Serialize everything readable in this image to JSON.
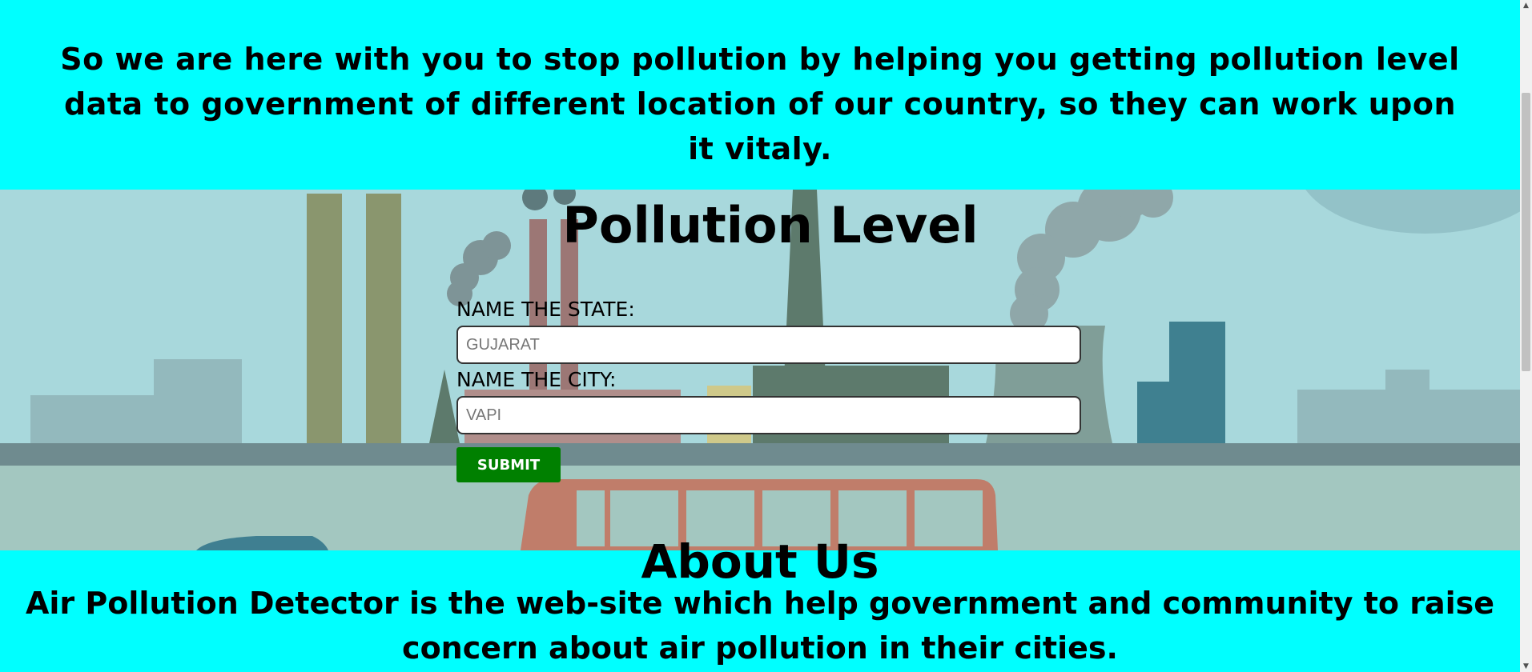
{
  "intro": {
    "text": "So we are here with you to stop pollution by helping you getting pollution level data to government of different location of our country, so they can work upon it vitaly."
  },
  "form": {
    "title": "Pollution Level",
    "state_label": "NAME THE STATE:",
    "state_placeholder": "GUJARAT",
    "city_label": "NAME THE CITY:",
    "city_placeholder": "VAPI",
    "submit_label": "SUBMIT"
  },
  "about": {
    "heading": "About Us",
    "text": "Air Pollution Detector is the web-site which help government and community to raise concern about air pollution in their cities."
  },
  "colors": {
    "band_background": "#00ffff",
    "submit_button": "#008000",
    "scene_sky": "#a8d8dc"
  }
}
